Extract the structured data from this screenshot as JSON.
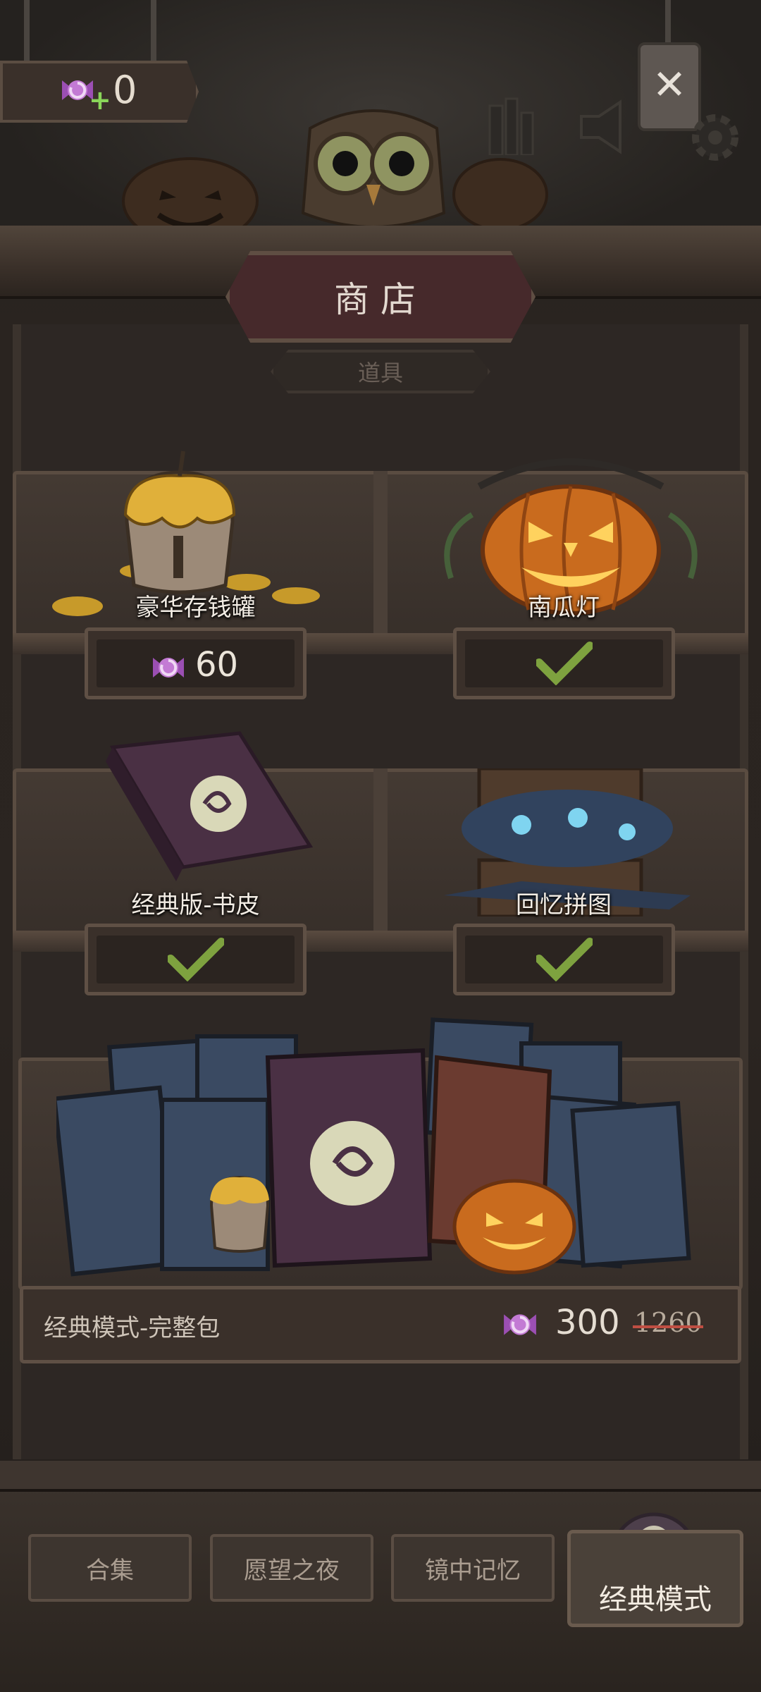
{
  "header": {
    "currency_value": "0",
    "currency_icon": "candy-icon",
    "close_icon": "close-icon"
  },
  "shop": {
    "title": "商店",
    "subtab": "道具"
  },
  "items": [
    {
      "name": "豪华存钱罐",
      "price": "60",
      "owned": false,
      "icon": "piggy-bank-icon"
    },
    {
      "name": "南瓜灯",
      "owned": true,
      "icon": "pumpkin-lantern-icon"
    },
    {
      "name": "经典版-书皮",
      "owned": true,
      "icon": "book-cover-icon"
    },
    {
      "name": "回忆拼图",
      "owned": true,
      "icon": "puzzle-box-icon"
    }
  ],
  "bundle": {
    "name": "经典模式-完整包",
    "price": "300",
    "original_price": "1260"
  },
  "bottom_nav": {
    "tabs": [
      "合集",
      "愿望之夜",
      "镜中记忆"
    ],
    "active": "经典模式"
  },
  "colors": {
    "check_green": "#7ea23f",
    "candy_purple": "#9b4fb3",
    "strike_red": "#c04f43"
  }
}
